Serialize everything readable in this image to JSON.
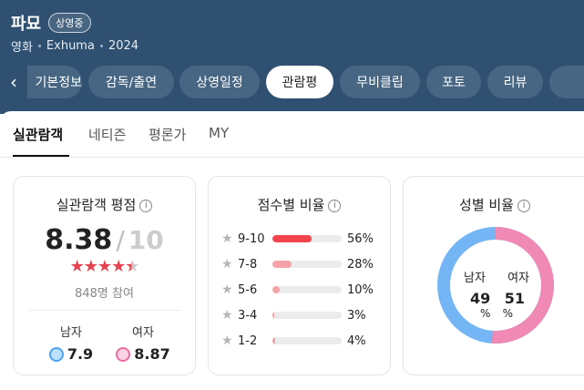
{
  "header": {
    "title": "파묘",
    "badge": "상영중",
    "meta": [
      "영화",
      "Exhuma",
      "2024"
    ],
    "tabs": [
      {
        "label": "기본정보",
        "active": false
      },
      {
        "label": "감독/출연",
        "active": false
      },
      {
        "label": "상영일정",
        "active": false
      },
      {
        "label": "관람평",
        "active": true
      },
      {
        "label": "무비클립",
        "active": false
      },
      {
        "label": "포토",
        "active": false
      },
      {
        "label": "리뷰",
        "active": false
      },
      {
        "label": "",
        "active": false
      }
    ],
    "bg_color": "#2f5070",
    "pill_color": "#476683"
  },
  "subtabs": [
    {
      "label": "실관람객",
      "active": true
    },
    {
      "label": "네티즌",
      "active": false
    },
    {
      "label": "평론가",
      "active": false
    },
    {
      "label": "MY",
      "active": false
    }
  ],
  "rating_card": {
    "title": "실관람객 평점",
    "info_icon": "info-icon",
    "score": "8.38",
    "separator": "/",
    "max": "10",
    "stars_rating": 4.5,
    "stars_max": 5,
    "participants": "848명 참여",
    "male_label": "남자",
    "male_score": "7.9",
    "female_label": "여자",
    "female_score": "8.87",
    "accent": "#e8414f"
  },
  "distribution_card": {
    "title": "점수별 비율",
    "rows": [
      {
        "label": "9-10",
        "pct": "56%",
        "value": 56,
        "color": "#f2444f"
      },
      {
        "label": "7-8",
        "pct": "28%",
        "value": 28,
        "color": "#f5a3a8"
      },
      {
        "label": "5-6",
        "pct": "10%",
        "value": 10,
        "color": "#f5a3a8"
      },
      {
        "label": "3-4",
        "pct": "3%",
        "value": 3,
        "color": "#f5a3a8"
      },
      {
        "label": "1-2",
        "pct": "4%",
        "value": 4,
        "color": "#f5a3a8"
      }
    ]
  },
  "gender_card": {
    "title": "성별 비율",
    "male_label": "남자",
    "female_label": "여자",
    "male_value": "49",
    "female_value": "51",
    "unit": "%",
    "male_pct": 49,
    "female_pct": 51,
    "male_color": "#74b6f5",
    "female_color": "#f08ab5"
  }
}
